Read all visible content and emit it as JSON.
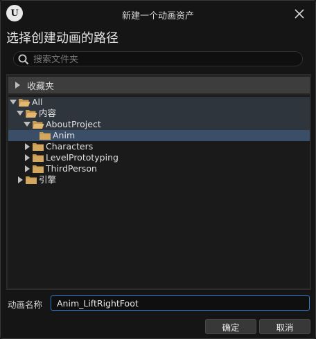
{
  "window": {
    "title": "新建一个动画资产",
    "logo_text": "U",
    "logo_icon": "unreal-logo-icon",
    "close_icon": "close-icon"
  },
  "heading": "选择创建动画的路径",
  "search": {
    "placeholder": "搜索文件夹",
    "value": "",
    "icon": "search-icon"
  },
  "favorites": {
    "label": "收藏夹",
    "expanded": false
  },
  "tree": {
    "items": [
      {
        "label": "All",
        "depth": 0,
        "expanded": true,
        "has_children": true,
        "selected": false,
        "folder": "open"
      },
      {
        "label": "内容",
        "depth": 1,
        "expanded": true,
        "has_children": true,
        "selected": false,
        "folder": "open"
      },
      {
        "label": "AboutProject",
        "depth": 2,
        "expanded": true,
        "has_children": true,
        "selected": false,
        "folder": "open"
      },
      {
        "label": "Anim",
        "depth": 3,
        "expanded": false,
        "has_children": false,
        "selected": true,
        "folder": "closed"
      },
      {
        "label": "Characters",
        "depth": 2,
        "expanded": false,
        "has_children": true,
        "selected": false,
        "folder": "closed"
      },
      {
        "label": "LevelPrototyping",
        "depth": 2,
        "expanded": false,
        "has_children": true,
        "selected": false,
        "folder": "closed"
      },
      {
        "label": "ThirdPerson",
        "depth": 2,
        "expanded": false,
        "has_children": true,
        "selected": false,
        "folder": "closed"
      },
      {
        "label": "引擎",
        "depth": 1,
        "expanded": false,
        "has_children": true,
        "selected": false,
        "folder": "closed"
      }
    ]
  },
  "name_field": {
    "label": "动画名称",
    "value": "Anim_LiftRightFoot"
  },
  "buttons": {
    "ok": "确定",
    "cancel": "取消"
  },
  "colors": {
    "selection": "#3b4e68",
    "folder": "#c79a52",
    "focus_border": "#2f78c9"
  }
}
